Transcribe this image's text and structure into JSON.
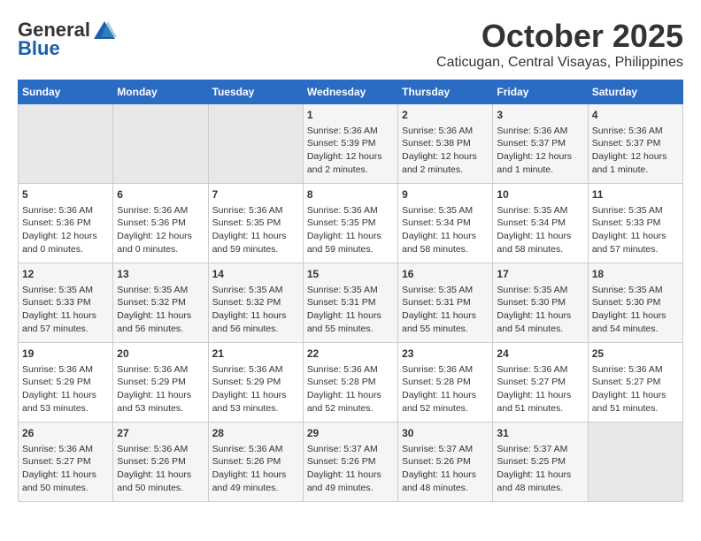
{
  "header": {
    "logo_general": "General",
    "logo_blue": "Blue",
    "month_title": "October 2025",
    "location": "Caticugan, Central Visayas, Philippines"
  },
  "calendar": {
    "days_of_week": [
      "Sunday",
      "Monday",
      "Tuesday",
      "Wednesday",
      "Thursday",
      "Friday",
      "Saturday"
    ],
    "weeks": [
      [
        {
          "day": "",
          "data": ""
        },
        {
          "day": "",
          "data": ""
        },
        {
          "day": "",
          "data": ""
        },
        {
          "day": "1",
          "data": "Sunrise: 5:36 AM\nSunset: 5:39 PM\nDaylight: 12 hours\nand 2 minutes."
        },
        {
          "day": "2",
          "data": "Sunrise: 5:36 AM\nSunset: 5:38 PM\nDaylight: 12 hours\nand 2 minutes."
        },
        {
          "day": "3",
          "data": "Sunrise: 5:36 AM\nSunset: 5:37 PM\nDaylight: 12 hours\nand 1 minute."
        },
        {
          "day": "4",
          "data": "Sunrise: 5:36 AM\nSunset: 5:37 PM\nDaylight: 12 hours\nand 1 minute."
        }
      ],
      [
        {
          "day": "5",
          "data": "Sunrise: 5:36 AM\nSunset: 5:36 PM\nDaylight: 12 hours\nand 0 minutes."
        },
        {
          "day": "6",
          "data": "Sunrise: 5:36 AM\nSunset: 5:36 PM\nDaylight: 12 hours\nand 0 minutes."
        },
        {
          "day": "7",
          "data": "Sunrise: 5:36 AM\nSunset: 5:35 PM\nDaylight: 11 hours\nand 59 minutes."
        },
        {
          "day": "8",
          "data": "Sunrise: 5:36 AM\nSunset: 5:35 PM\nDaylight: 11 hours\nand 59 minutes."
        },
        {
          "day": "9",
          "data": "Sunrise: 5:35 AM\nSunset: 5:34 PM\nDaylight: 11 hours\nand 58 minutes."
        },
        {
          "day": "10",
          "data": "Sunrise: 5:35 AM\nSunset: 5:34 PM\nDaylight: 11 hours\nand 58 minutes."
        },
        {
          "day": "11",
          "data": "Sunrise: 5:35 AM\nSunset: 5:33 PM\nDaylight: 11 hours\nand 57 minutes."
        }
      ],
      [
        {
          "day": "12",
          "data": "Sunrise: 5:35 AM\nSunset: 5:33 PM\nDaylight: 11 hours\nand 57 minutes."
        },
        {
          "day": "13",
          "data": "Sunrise: 5:35 AM\nSunset: 5:32 PM\nDaylight: 11 hours\nand 56 minutes."
        },
        {
          "day": "14",
          "data": "Sunrise: 5:35 AM\nSunset: 5:32 PM\nDaylight: 11 hours\nand 56 minutes."
        },
        {
          "day": "15",
          "data": "Sunrise: 5:35 AM\nSunset: 5:31 PM\nDaylight: 11 hours\nand 55 minutes."
        },
        {
          "day": "16",
          "data": "Sunrise: 5:35 AM\nSunset: 5:31 PM\nDaylight: 11 hours\nand 55 minutes."
        },
        {
          "day": "17",
          "data": "Sunrise: 5:35 AM\nSunset: 5:30 PM\nDaylight: 11 hours\nand 54 minutes."
        },
        {
          "day": "18",
          "data": "Sunrise: 5:35 AM\nSunset: 5:30 PM\nDaylight: 11 hours\nand 54 minutes."
        }
      ],
      [
        {
          "day": "19",
          "data": "Sunrise: 5:36 AM\nSunset: 5:29 PM\nDaylight: 11 hours\nand 53 minutes."
        },
        {
          "day": "20",
          "data": "Sunrise: 5:36 AM\nSunset: 5:29 PM\nDaylight: 11 hours\nand 53 minutes."
        },
        {
          "day": "21",
          "data": "Sunrise: 5:36 AM\nSunset: 5:29 PM\nDaylight: 11 hours\nand 53 minutes."
        },
        {
          "day": "22",
          "data": "Sunrise: 5:36 AM\nSunset: 5:28 PM\nDaylight: 11 hours\nand 52 minutes."
        },
        {
          "day": "23",
          "data": "Sunrise: 5:36 AM\nSunset: 5:28 PM\nDaylight: 11 hours\nand 52 minutes."
        },
        {
          "day": "24",
          "data": "Sunrise: 5:36 AM\nSunset: 5:27 PM\nDaylight: 11 hours\nand 51 minutes."
        },
        {
          "day": "25",
          "data": "Sunrise: 5:36 AM\nSunset: 5:27 PM\nDaylight: 11 hours\nand 51 minutes."
        }
      ],
      [
        {
          "day": "26",
          "data": "Sunrise: 5:36 AM\nSunset: 5:27 PM\nDaylight: 11 hours\nand 50 minutes."
        },
        {
          "day": "27",
          "data": "Sunrise: 5:36 AM\nSunset: 5:26 PM\nDaylight: 11 hours\nand 50 minutes."
        },
        {
          "day": "28",
          "data": "Sunrise: 5:36 AM\nSunset: 5:26 PM\nDaylight: 11 hours\nand 49 minutes."
        },
        {
          "day": "29",
          "data": "Sunrise: 5:37 AM\nSunset: 5:26 PM\nDaylight: 11 hours\nand 49 minutes."
        },
        {
          "day": "30",
          "data": "Sunrise: 5:37 AM\nSunset: 5:26 PM\nDaylight: 11 hours\nand 48 minutes."
        },
        {
          "day": "31",
          "data": "Sunrise: 5:37 AM\nSunset: 5:25 PM\nDaylight: 11 hours\nand 48 minutes."
        },
        {
          "day": "",
          "data": ""
        }
      ]
    ]
  }
}
